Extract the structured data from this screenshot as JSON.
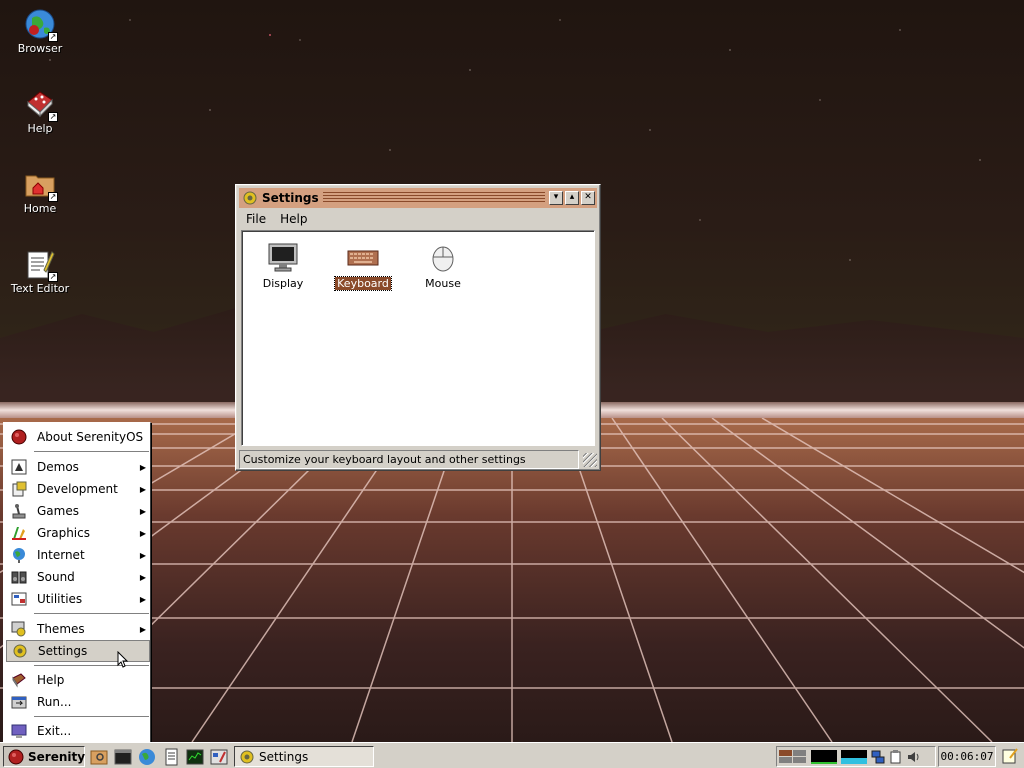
{
  "desktop": {
    "icons": [
      {
        "label": "Browser"
      },
      {
        "label": "Help"
      },
      {
        "label": "Home"
      },
      {
        "label": "Text Editor"
      }
    ]
  },
  "settings_window": {
    "title": "Settings",
    "menu": {
      "file": "File",
      "help": "Help"
    },
    "applets": [
      {
        "label": "Display",
        "selected": false
      },
      {
        "label": "Keyboard",
        "selected": true
      },
      {
        "label": "Mouse",
        "selected": false
      }
    ],
    "status": "Customize your keyboard layout and other settings"
  },
  "start_menu": {
    "items": {
      "about": "About SerenityOS",
      "demos": "Demos",
      "development": "Development",
      "games": "Games",
      "graphics": "Graphics",
      "internet": "Internet",
      "sound": "Sound",
      "utilities": "Utilities",
      "themes": "Themes",
      "settings": "Settings",
      "help": "Help",
      "run": "Run...",
      "exit": "Exit..."
    },
    "hovered": "Settings"
  },
  "taskbar": {
    "start_label": "Serenity",
    "task_label": "Settings",
    "clock": "00:06:07"
  },
  "colors": {
    "accent": "#8a4a2a",
    "title_bar": "#d4a080",
    "chrome": "#d4d0c8"
  }
}
